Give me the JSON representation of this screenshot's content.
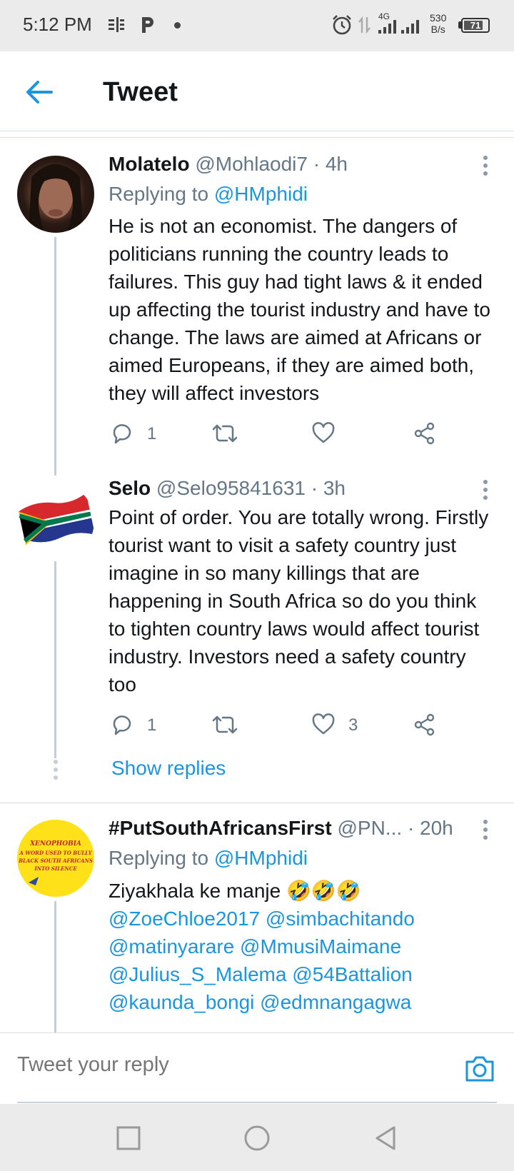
{
  "status_bar": {
    "time": "5:12 PM",
    "network": "4G",
    "speed_value": "530",
    "speed_unit": "B/s",
    "battery": "71",
    "icons": [
      "notification-icon",
      "p-app-icon",
      "alarm-icon",
      "data-arrows-icon",
      "signal-icon",
      "battery-icon"
    ]
  },
  "header": {
    "title": "Tweet",
    "back_icon": "arrow-left-icon"
  },
  "tweets": [
    {
      "name": "Molatelo",
      "handle": "@Mohlaodi7",
      "time": "· 4h",
      "replying_prefix": "Replying to",
      "replying_to": "@HMphidi",
      "text": "He is not an economist. The dangers of politicians running the country leads to failures. This guy had tight laws & it ended up affecting the tourist industry and have to change. The laws are aimed at Africans or aimed Europeans, if they are aimed both, they will affect investors",
      "reply_count": "1",
      "retweet_count": "",
      "like_count": ""
    },
    {
      "name": "Selo",
      "handle": "@Selo95841631",
      "time": "· 3h",
      "text": "Point of order. You are totally wrong. Firstly tourist want to visit a safety country just imagine in so many killings that are happening in South Africa so do you think to tighten country laws would affect tourist industry. Investors need a safety country too",
      "reply_count": "1",
      "retweet_count": "",
      "like_count": "3",
      "show_replies": "Show replies"
    },
    {
      "name": "#PutSouthAfricansFirst",
      "handle": "@PN...",
      "time": "· 20h",
      "replying_prefix": "Replying to",
      "replying_to": "@HMphidi",
      "text_start": "Ziyakhala ke manje",
      "emojis": "🤣🤣🤣",
      "mentions": [
        "@ZoeChloe2017",
        "@simbachitando",
        "@matinyarare",
        "@MmusiMaimane",
        "@Julius_S_Malema",
        "@54Battalion",
        "@kaunda_bongi",
        "@edmnangagwa"
      ],
      "avatar_text": [
        "XENOPHOBIA",
        "A WORD USED TO BULLY",
        "BLACK SOUTH AFRICANS",
        "INTO SILENCE"
      ]
    }
  ],
  "reply_bar": {
    "placeholder": "Tweet your reply",
    "camera_icon": "camera-icon"
  },
  "nav_bar": {
    "icons": [
      "recents-square-icon",
      "home-circle-icon",
      "back-triangle-icon"
    ]
  },
  "colors": {
    "accent": "#1b95e0",
    "muted": "#657786",
    "divider": "#d9dfe3",
    "system_bar": "#ebebeb"
  }
}
